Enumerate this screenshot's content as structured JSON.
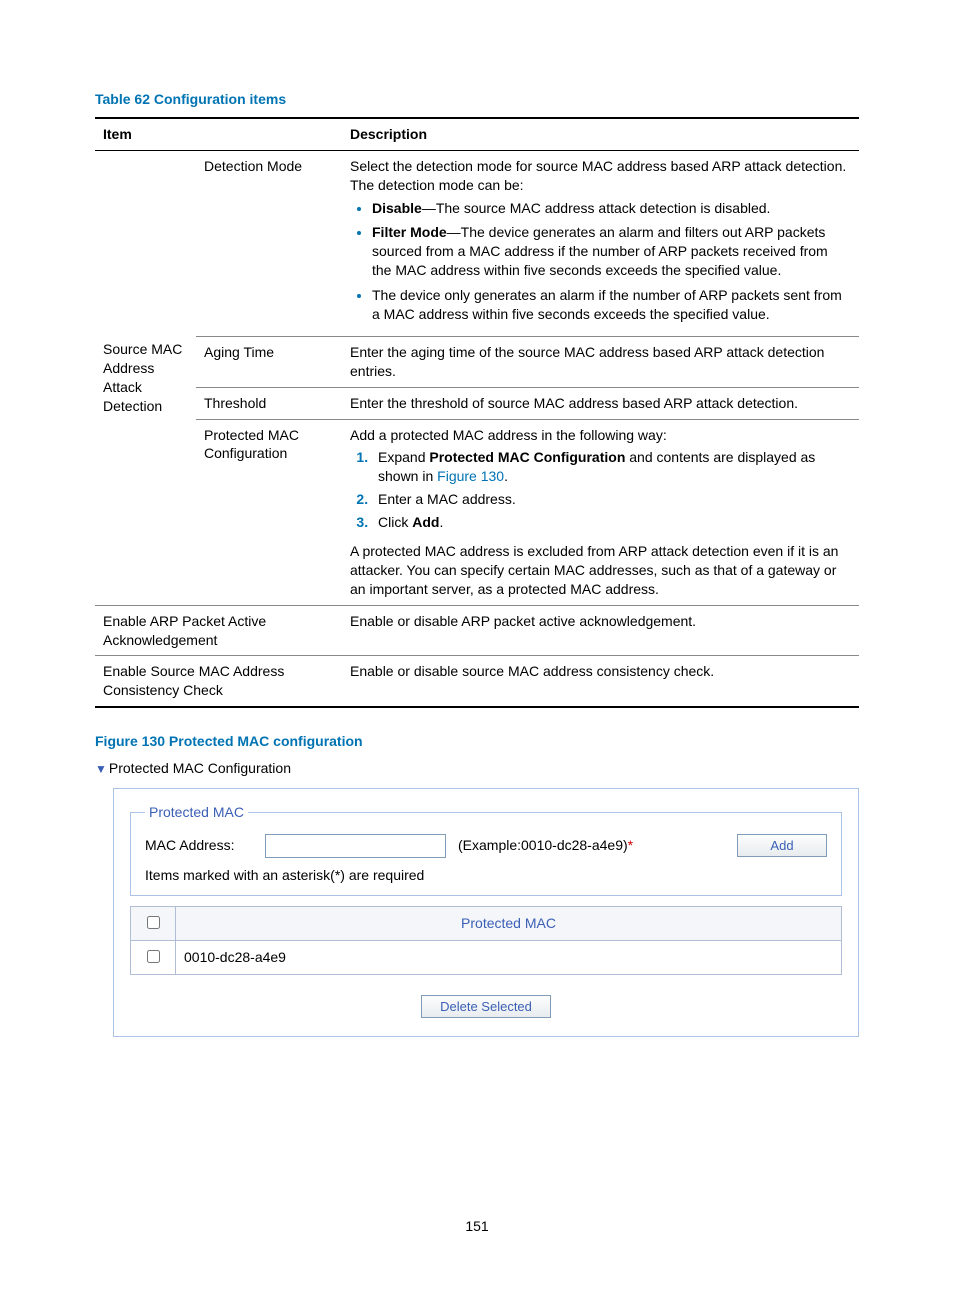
{
  "table_title": "Table 62 Configuration items",
  "headers": {
    "item": "Item",
    "desc": "Description"
  },
  "group_label": "Source MAC Address Attack Detection",
  "rows": {
    "detection_mode": {
      "label": "Detection Mode",
      "intro": "Select the detection mode for source MAC address based ARP attack detection. The detection mode can be:",
      "b1_bold": "Disable",
      "b1_rest": "—The source MAC address attack detection is disabled.",
      "b2_bold": "Filter Mode",
      "b2_rest": "—The device generates an alarm and filters out ARP packets sourced from a MAC address if the number of ARP packets received from the MAC address within five seconds exceeds the specified value.",
      "b3": "The device only generates an alarm if the number of ARP packets sent from a MAC address within five seconds exceeds the specified value."
    },
    "aging": {
      "label": "Aging Time",
      "desc": "Enter the aging time of the source MAC address based ARP attack detection entries."
    },
    "threshold": {
      "label": "Threshold",
      "desc": "Enter the threshold of source MAC address based ARP attack detection."
    },
    "protected": {
      "label": "Protected MAC Configuration",
      "intro": "Add a protected MAC address in the following way:",
      "s1a": "Expand ",
      "s1b": "Protected MAC Configuration",
      "s1c": " and contents are displayed as shown in ",
      "s1link": "Figure 130",
      "s1d": ".",
      "s2": "Enter a MAC address.",
      "s3a": "Click ",
      "s3b": "Add",
      "s3c": ".",
      "post": "A protected MAC address is excluded from ARP attack detection even if it is an attacker. You can specify certain MAC addresses, such as that of a gateway or an important server, as a protected MAC address."
    },
    "enable_ack": {
      "label": "Enable ARP Packet Active Acknowledgement",
      "desc": "Enable or disable ARP packet active acknowledgement."
    },
    "enable_cons": {
      "label": "Enable Source MAC Address Consistency Check",
      "desc": "Enable or disable source MAC address consistency check."
    }
  },
  "figure_title": "Figure 130 Protected MAC configuration",
  "panel": {
    "header": "Protected MAC Configuration",
    "legend": "Protected MAC",
    "mac_label": "MAC Address:",
    "example": "(Example:0010-dc28-a4e9)",
    "asterisk": "*",
    "add": "Add",
    "required_note": "Items marked with an asterisk(*) are required",
    "col_header": "Protected MAC",
    "row_value": "0010-dc28-a4e9",
    "delete": "Delete Selected"
  },
  "page_number": "151"
}
